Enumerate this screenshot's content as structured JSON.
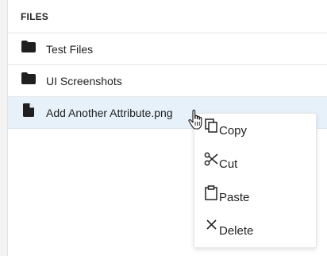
{
  "panel": {
    "header": "FILES"
  },
  "files": [
    {
      "label": "Test Files",
      "icon": "folder-icon"
    },
    {
      "label": "UI Screenshots",
      "icon": "folder-icon"
    },
    {
      "label": "Add Another Attribute.png",
      "icon": "file-icon"
    }
  ],
  "context_menu": {
    "items": [
      {
        "label": "Copy",
        "icon": "copy-icon"
      },
      {
        "label": "Cut",
        "icon": "scissors-icon"
      },
      {
        "label": "Paste",
        "icon": "clipboard-icon"
      },
      {
        "label": "Delete",
        "icon": "close-icon"
      }
    ]
  },
  "colors": {
    "selected_row": "#e6f1fa",
    "text": "#222222",
    "border": "#e3e3e3"
  }
}
